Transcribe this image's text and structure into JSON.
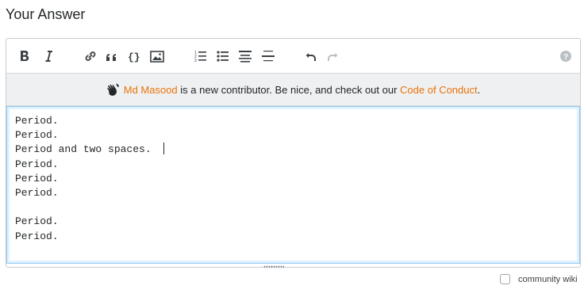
{
  "heading": "Your Answer",
  "toolbar": {
    "buttons": [
      {
        "name": "bold",
        "icon": "bold-icon"
      },
      {
        "name": "italic",
        "icon": "italic-icon"
      },
      {
        "name": "link",
        "icon": "link-icon"
      },
      {
        "name": "blockquote",
        "icon": "quote-icon"
      },
      {
        "name": "code",
        "icon": "code-icon"
      },
      {
        "name": "image",
        "icon": "image-icon"
      },
      {
        "name": "ordered-list",
        "icon": "ordered-list-icon"
      },
      {
        "name": "bullet-list",
        "icon": "bullet-list-icon"
      },
      {
        "name": "heading",
        "icon": "heading-icon"
      },
      {
        "name": "horizontal-rule",
        "icon": "horizontal-rule-icon"
      },
      {
        "name": "undo",
        "icon": "undo-icon"
      },
      {
        "name": "redo",
        "icon": "redo-icon"
      },
      {
        "name": "help",
        "icon": "help-icon"
      }
    ]
  },
  "notice": {
    "user": "Md Masood",
    "middle": " is a new contributor. Be nice, and check out our ",
    "link": "Code of Conduct",
    "end": "."
  },
  "editor": {
    "lines": [
      "Period.",
      "Period.",
      "Period and two spaces.  ",
      "Period.",
      "Period.",
      "Period.",
      "",
      "Period.",
      "Period."
    ]
  },
  "community_wiki": "community wiki",
  "colors": {
    "accent": "#e8740c",
    "focus_border": "#8fc9f0",
    "notice_bg": "#eff0f1"
  }
}
